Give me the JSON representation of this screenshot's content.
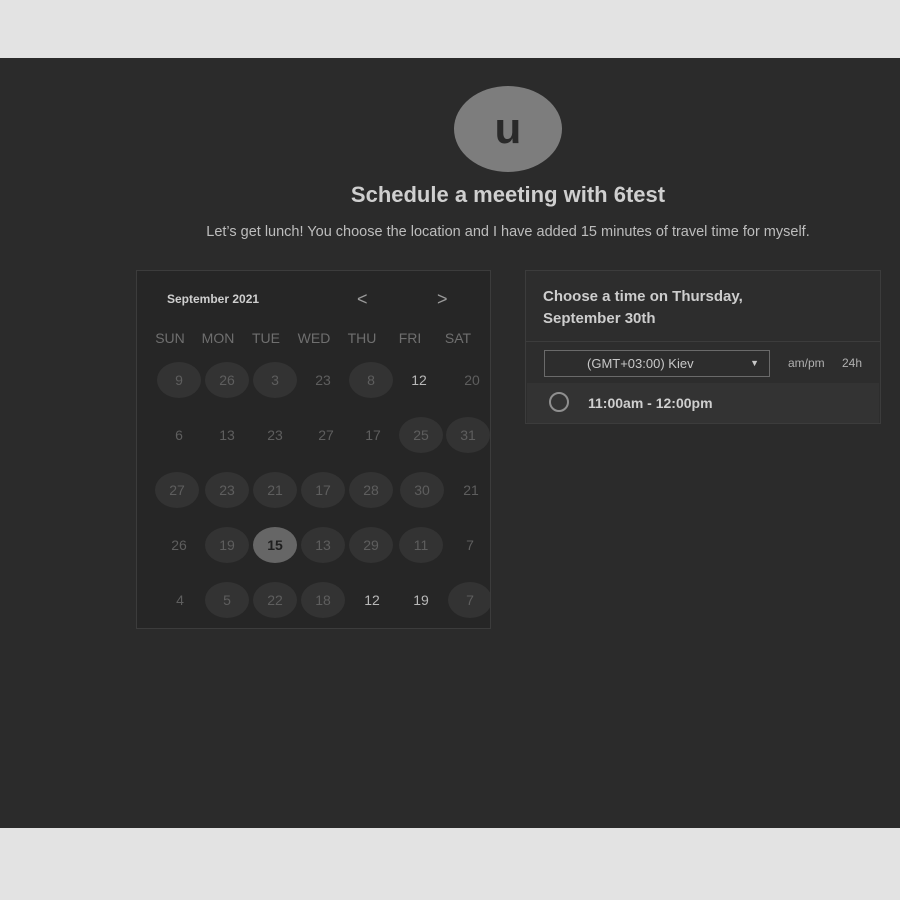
{
  "header": {
    "avatar_letter": "u",
    "title": "Schedule a meeting with 6test",
    "subtitle": "Let’s get lunch! You choose the location and I have added 15 minutes of travel time for myself."
  },
  "calendar": {
    "month_label": "September 2021",
    "prev_label": "<",
    "next_label": ">",
    "weekdays": [
      "SUN",
      "MON",
      "TUE",
      "WED",
      "THU",
      "FRI",
      "SAT"
    ],
    "weeks": [
      [
        "9",
        "26",
        "3",
        "23",
        "8",
        "12",
        "20"
      ],
      [
        "6",
        "13",
        "23",
        "27",
        "17",
        "25",
        "31"
      ],
      [
        "27",
        "23",
        "21",
        "17",
        "28",
        "30",
        "21"
      ],
      [
        "26",
        "19",
        "15",
        "13",
        "29",
        "11",
        "7"
      ],
      [
        "4",
        "5",
        "22",
        "18",
        "12",
        "19",
        "7"
      ]
    ],
    "selected_day": "15"
  },
  "time_picker": {
    "heading_line1": "Choose a time on Thursday,",
    "heading_line2": "September 30th",
    "timezone": "(GMT+03:00) Kiev",
    "format_ampm": "am/pm",
    "format_24h": "24h",
    "slots": [
      "11:00am - 12:00pm"
    ]
  },
  "colors": {
    "page_bg": "#e3e3e3",
    "panel_bg": "#2b2b2b",
    "avatar_bg": "#7d7d7d",
    "selected_day_bg": "#666666"
  }
}
